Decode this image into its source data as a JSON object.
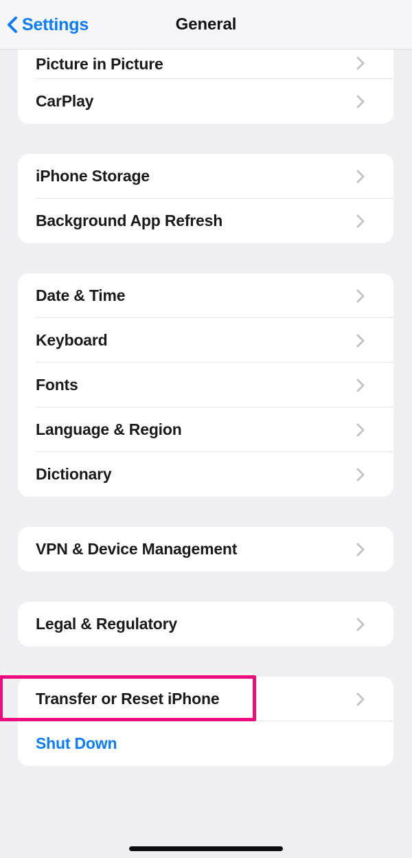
{
  "navbar": {
    "back_label": "Settings",
    "back_icon": "chevron-left-icon",
    "title": "General"
  },
  "colors": {
    "accent_blue": "#0a7cff",
    "highlight_magenta": "#ec0c7d",
    "page_background": "#f0f0f3",
    "card_background": "#ffffff",
    "chevron_gray": "#c3c3c8",
    "label_black": "#1a1a1a"
  },
  "groups": [
    {
      "name": "media-group",
      "clipped": true,
      "rows": [
        {
          "label": "Picture in Picture",
          "chevron": "chevron-right-icon",
          "style": "default"
        },
        {
          "label": "CarPlay",
          "chevron": "chevron-right-icon",
          "style": "default"
        }
      ]
    },
    {
      "name": "storage-group",
      "clipped": false,
      "rows": [
        {
          "label": "iPhone Storage",
          "chevron": "chevron-right-icon",
          "style": "default"
        },
        {
          "label": "Background App Refresh",
          "chevron": "chevron-right-icon",
          "style": "default"
        }
      ]
    },
    {
      "name": "locale-group",
      "clipped": false,
      "rows": [
        {
          "label": "Date & Time",
          "chevron": "chevron-right-icon",
          "style": "default"
        },
        {
          "label": "Keyboard",
          "chevron": "chevron-right-icon",
          "style": "default"
        },
        {
          "label": "Fonts",
          "chevron": "chevron-right-icon",
          "style": "default"
        },
        {
          "label": "Language & Region",
          "chevron": "chevron-right-icon",
          "style": "default"
        },
        {
          "label": "Dictionary",
          "chevron": "chevron-right-icon",
          "style": "default"
        }
      ]
    },
    {
      "name": "vpn-group",
      "clipped": false,
      "rows": [
        {
          "label": "VPN & Device Management",
          "chevron": "chevron-right-icon",
          "style": "default"
        }
      ]
    },
    {
      "name": "legal-group",
      "clipped": false,
      "rows": [
        {
          "label": "Legal & Regulatory",
          "chevron": "chevron-right-icon",
          "style": "default"
        }
      ]
    },
    {
      "name": "reset-group",
      "clipped": false,
      "rows": [
        {
          "label": "Transfer or Reset iPhone",
          "chevron": "chevron-right-icon",
          "style": "default",
          "highlighted": true
        },
        {
          "label": "Shut Down",
          "chevron": "none",
          "style": "accent"
        }
      ]
    }
  ]
}
